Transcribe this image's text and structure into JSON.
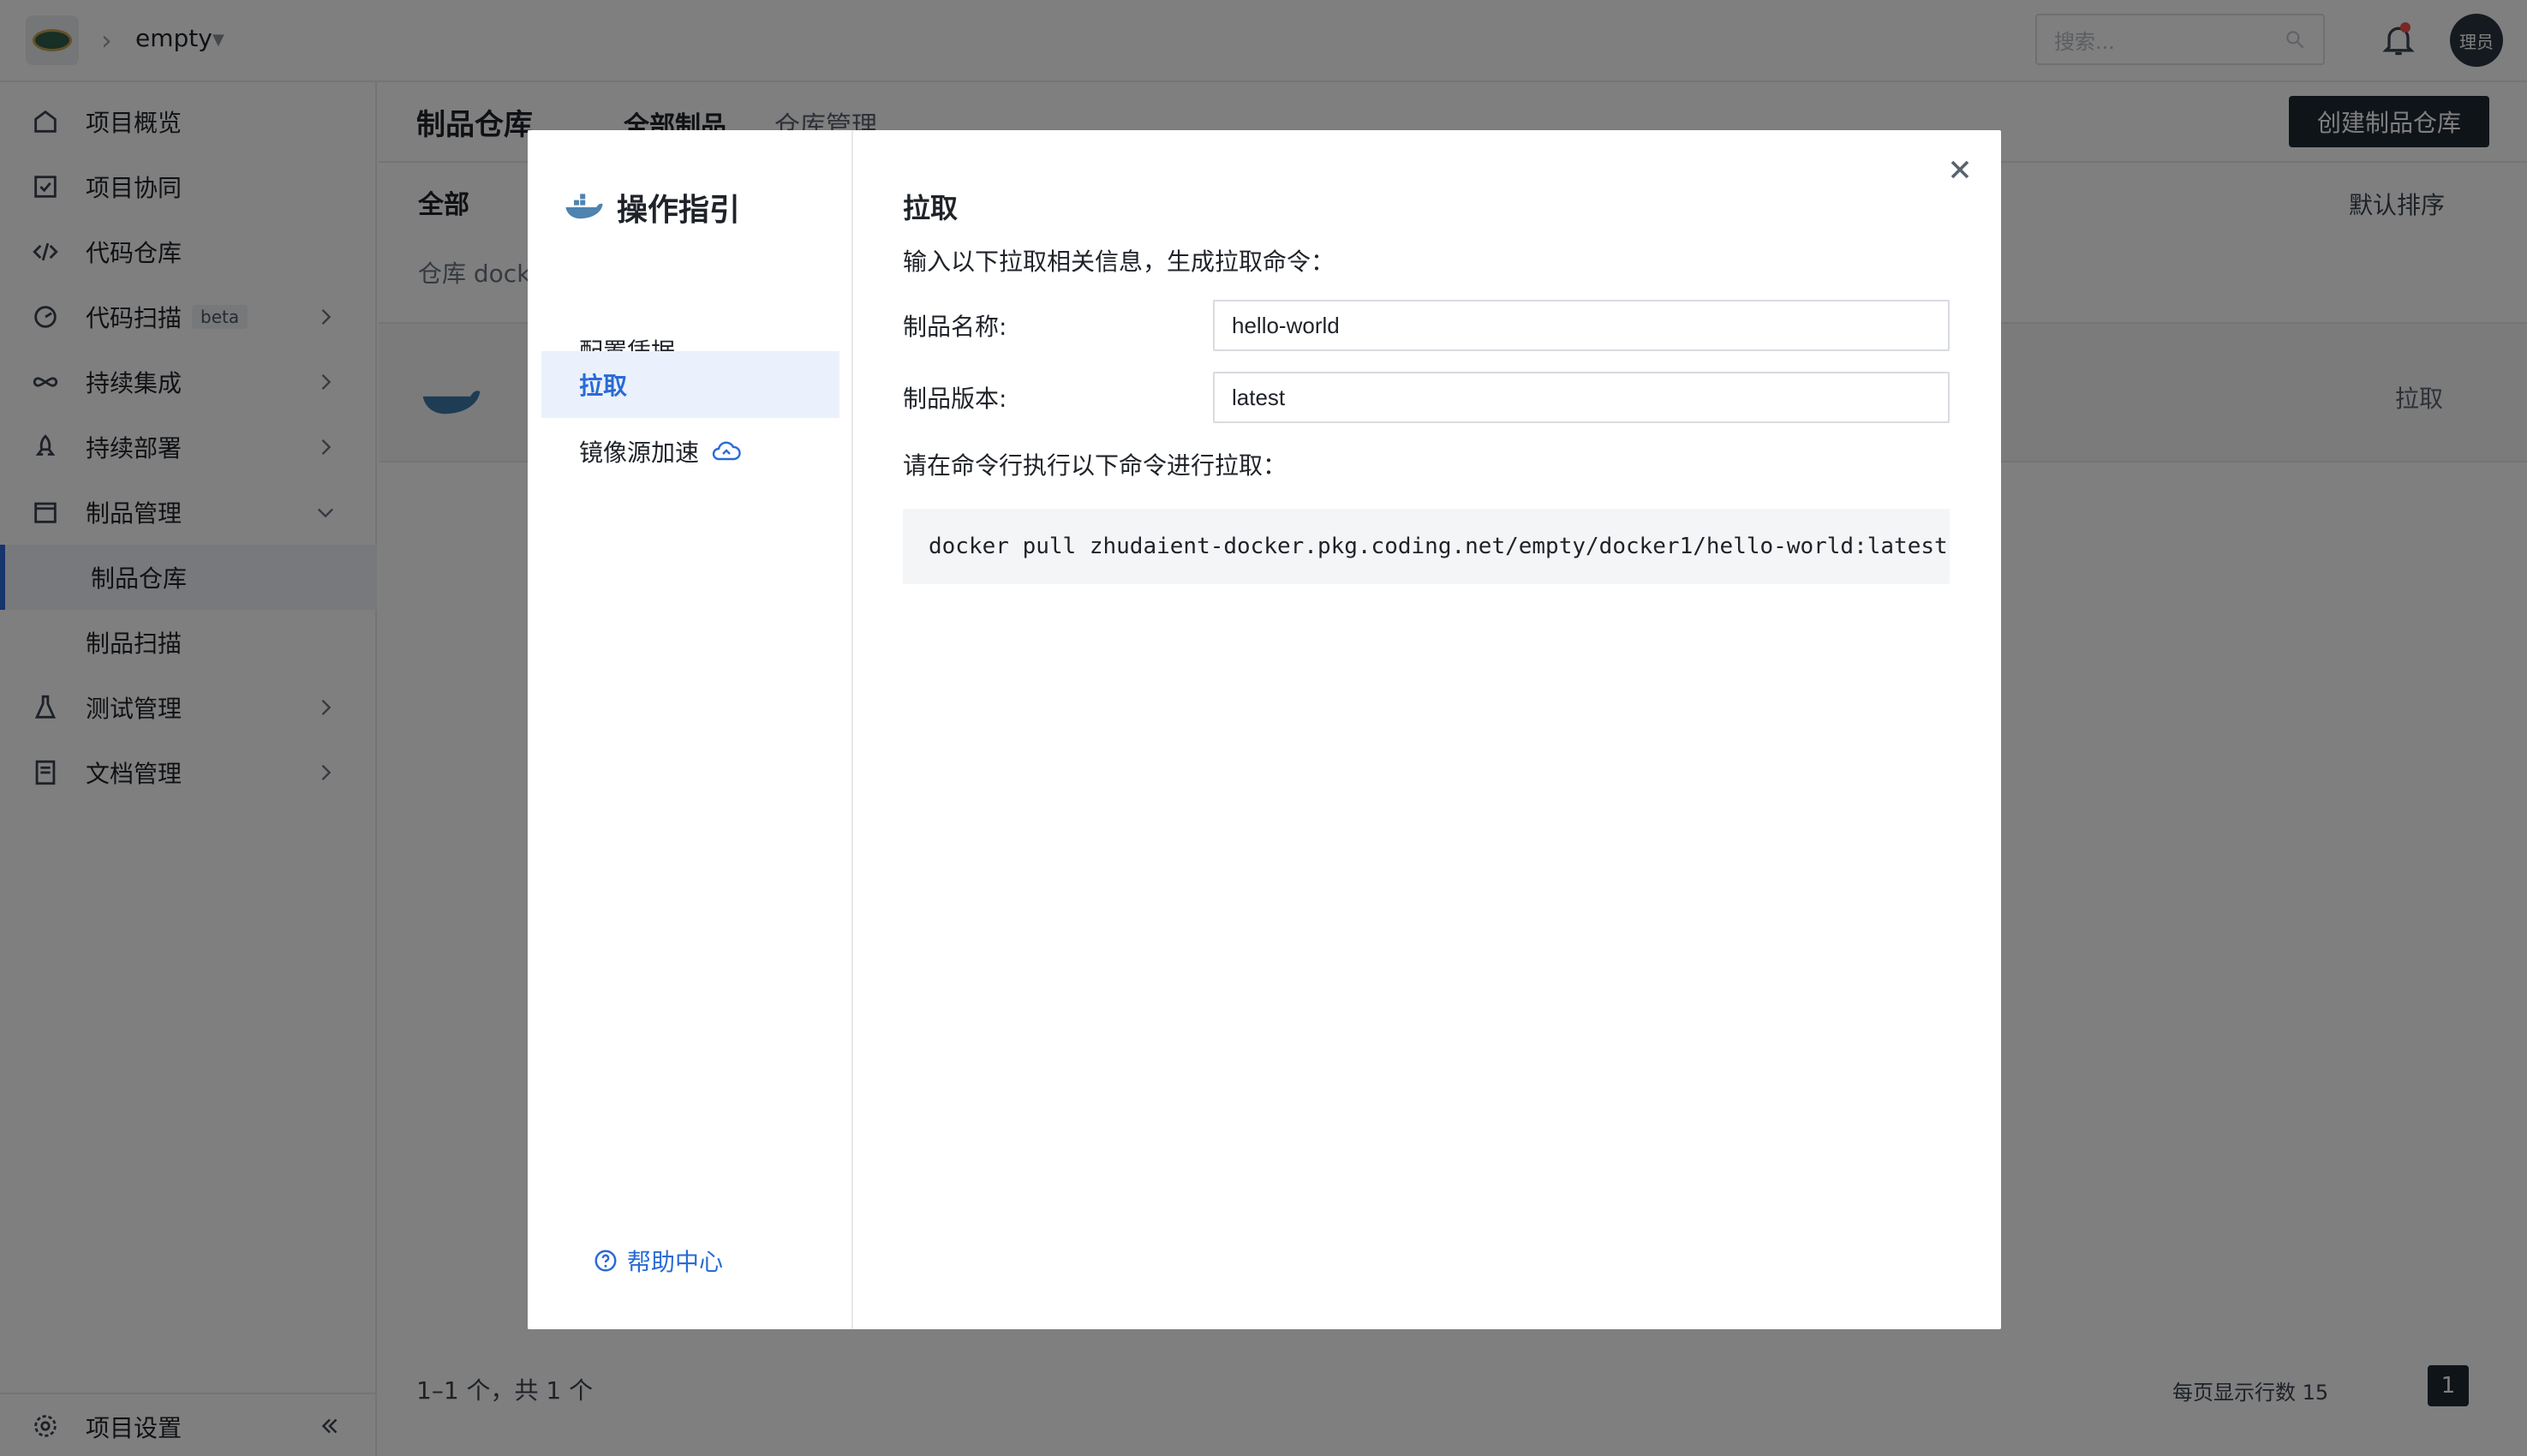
{
  "topbar": {
    "project_name": "empty",
    "search_placeholder": "搜索...",
    "avatar_text": "理员"
  },
  "sidebar": {
    "items": [
      {
        "label": "项目概览"
      },
      {
        "label": "项目协同"
      },
      {
        "label": "代码仓库"
      },
      {
        "label": "代码扫描",
        "badge": "beta"
      },
      {
        "label": "持续集成"
      },
      {
        "label": "持续部署"
      },
      {
        "label": "制品管理"
      },
      {
        "label": "制品仓库"
      },
      {
        "label": "制品扫描"
      },
      {
        "label": "测试管理"
      },
      {
        "label": "文档管理"
      }
    ],
    "settings_label": "项目设置"
  },
  "main": {
    "title": "制品仓库",
    "tab_all": "全部制品",
    "tab_manage": "仓库管理",
    "create_button": "创建制品仓库",
    "filter_all": "全部",
    "sort_label": "默认排序",
    "repo_label": "仓库 docke",
    "row_pull": "拉取",
    "footer_count": "1–1 个，共 1 个",
    "footer_per_page": "每页显示行数 15",
    "footer_page": "1"
  },
  "modal": {
    "title": "操作指引",
    "nav": [
      {
        "label": "配置凭据"
      },
      {
        "label": "拉取"
      },
      {
        "label": "镜像源加速"
      }
    ],
    "help_link": "帮助中心",
    "section_title": "拉取",
    "description": "输入以下拉取相关信息，生成拉取命令：",
    "name_label": "制品名称:",
    "name_value": "hello-world",
    "version_label": "制品版本:",
    "version_value": "latest",
    "command_hint": "请在命令行执行以下命令进行拉取：",
    "command": "docker pull zhudaient-docker.pkg.coding.net/empty/docker1/hello-world:latest"
  },
  "colors": {
    "accent": "#2a6bd6",
    "dark_button": "#1f2833",
    "overlay": "rgba(0,0,0,0.5)"
  }
}
